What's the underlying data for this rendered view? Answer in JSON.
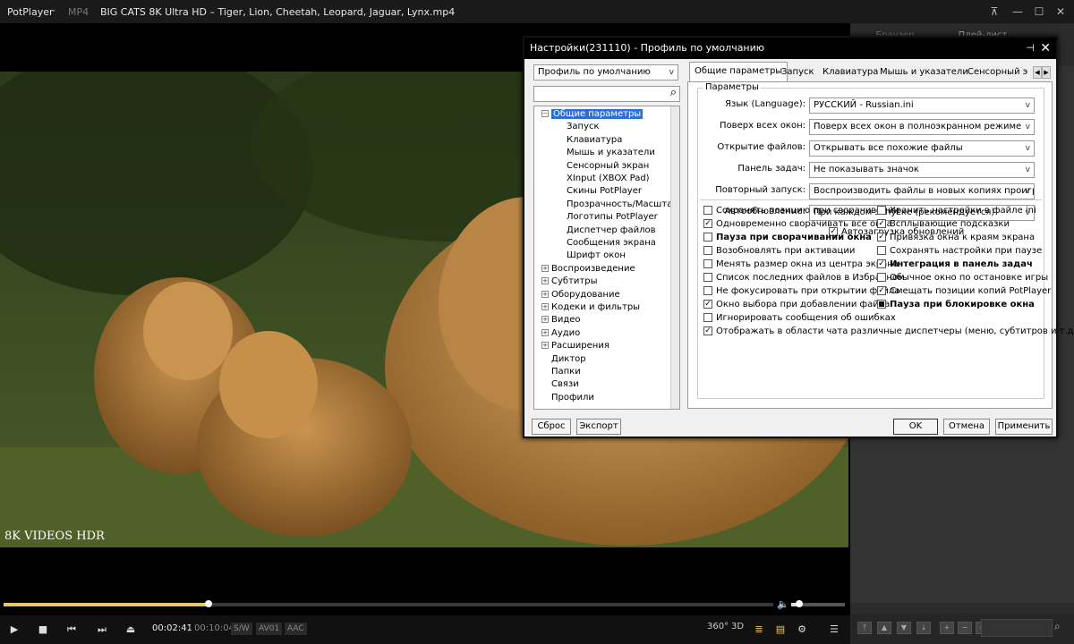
{
  "titlebar": {
    "app_name": "PotPlayer",
    "format": "MP4",
    "file_name": "BIG CATS 8K Ultra HD – Tiger, Lion, Cheetah, Leopard, Jaguar, Lynx.mp4"
  },
  "watermark": "8K VIDEOS HDR",
  "right_panel": {
    "tabs": [
      "Браузер",
      "Плей-лист"
    ]
  },
  "playback": {
    "current_time": "00:02:41",
    "separator": "/",
    "total_time": "00:10:04",
    "progress_fraction": 0.2666,
    "volume_fraction": 0.15,
    "tags": [
      "S/W",
      "AV01",
      "AAC"
    ],
    "right_labels": [
      "360°",
      "3D"
    ]
  },
  "dialog": {
    "title": "Настройки(231110) - Профиль по умолчанию",
    "profile": "Профиль по умолчанию",
    "search_value": "",
    "tree": [
      {
        "label": "Общие параметры",
        "level": 0,
        "expander": "−",
        "selected": true
      },
      {
        "label": "Запуск",
        "level": 1
      },
      {
        "label": "Клавиатура",
        "level": 1
      },
      {
        "label": "Мышь и указатели",
        "level": 1
      },
      {
        "label": "Сенсорный экран",
        "level": 1
      },
      {
        "label": "XInput (XBOX Pad)",
        "level": 1
      },
      {
        "label": "Скины PotPlayer",
        "level": 1
      },
      {
        "label": "Прозрачность/Масштаб",
        "level": 1
      },
      {
        "label": "Логотипы PotPlayer",
        "level": 1
      },
      {
        "label": "Диспетчер файлов",
        "level": 1
      },
      {
        "label": "Сообщения экрана",
        "level": 1
      },
      {
        "label": "Шрифт окон",
        "level": 1
      },
      {
        "label": "Воспроизведение",
        "level": 0,
        "expander": "+"
      },
      {
        "label": "Субтитры",
        "level": 0,
        "expander": "+"
      },
      {
        "label": "Оборудование",
        "level": 0,
        "expander": "+"
      },
      {
        "label": "Кодеки и фильтры",
        "level": 0,
        "expander": "+"
      },
      {
        "label": "Видео",
        "level": 0,
        "expander": "+"
      },
      {
        "label": "Аудио",
        "level": 0,
        "expander": "+"
      },
      {
        "label": "Расширения",
        "level": 0,
        "expander": "+"
      },
      {
        "label": "Диктор",
        "level": 0
      },
      {
        "label": "Папки",
        "level": 0
      },
      {
        "label": "Связи",
        "level": 0
      },
      {
        "label": "Профили",
        "level": 0
      }
    ],
    "tabs": [
      "Общие параметры",
      "Запуск",
      "Клавиатура",
      "Мышь и указатели",
      "Сенсорный э"
    ],
    "group_title": "Параметры",
    "params": [
      {
        "label": "Язык (Language):",
        "value": "РУССКИЙ - Russian.ini"
      },
      {
        "label": "Поверх всех окон:",
        "value": "Поверх всех окон в полноэкранном режиме"
      },
      {
        "label": "Открытие файлов:",
        "value": "Открывать все похожие файлы"
      },
      {
        "label": "Панель задач:",
        "value": "Не показывать значок"
      },
      {
        "label": "Повторный запуск:",
        "value": "Воспроизводить файлы в новых копиях проигрыват"
      },
      {
        "label": "Автообновление:",
        "value": "При каждом запуске (рекомендуется)"
      }
    ],
    "autoupdate_check": {
      "label": "Автозагрузка обновлений",
      "checked": true
    },
    "checks_left": [
      {
        "label": "Сохранять позицию при сворачивании",
        "checked": false
      },
      {
        "label": "Одновременно сворачивать все окна",
        "checked": true
      },
      {
        "label": "Пауза при сворачивании окна",
        "checked": false,
        "bold": true
      },
      {
        "label": "Возобновлять при активации",
        "checked": false
      },
      {
        "label": "Менять размер окна из центра экрана",
        "checked": false
      },
      {
        "label": "Список последних файлов в Избранном",
        "checked": false
      },
      {
        "label": "Не фокусировать при открытии файла",
        "checked": false
      },
      {
        "label": "Окно выбора при добавлении файла",
        "checked": true
      },
      {
        "label": "Игнорировать сообщения об ошибках",
        "checked": false
      },
      {
        "label": "Отображать в области чата различные диспетчеры (меню, субтитров и т.д.)",
        "checked": true
      }
    ],
    "checks_right": [
      {
        "label": "Хранить настройки в файле ini",
        "checked": false
      },
      {
        "label": "Всплывающие подсказки",
        "checked": true
      },
      {
        "label": "Привязка окна к краям экрана",
        "checked": true
      },
      {
        "label": "Сохранять настройки при паузе",
        "checked": false
      },
      {
        "label": "Интеграция в панель задач",
        "checked": true,
        "bold": true
      },
      {
        "label": "Обычное окно по остановке игры",
        "checked": false
      },
      {
        "label": "Смещать позиции копий PotPlayer",
        "checked": true
      },
      {
        "label": "Пауза при блокировке окна",
        "checked": "partial",
        "bold": true
      }
    ],
    "buttons": {
      "reset": "Сброс",
      "export": "Экспорт",
      "ok": "OK",
      "cancel": "Отмена",
      "apply": "Применить"
    }
  },
  "colors": {
    "accent_gold": "#e8c76a",
    "selection_blue": "#2e6fd6"
  }
}
